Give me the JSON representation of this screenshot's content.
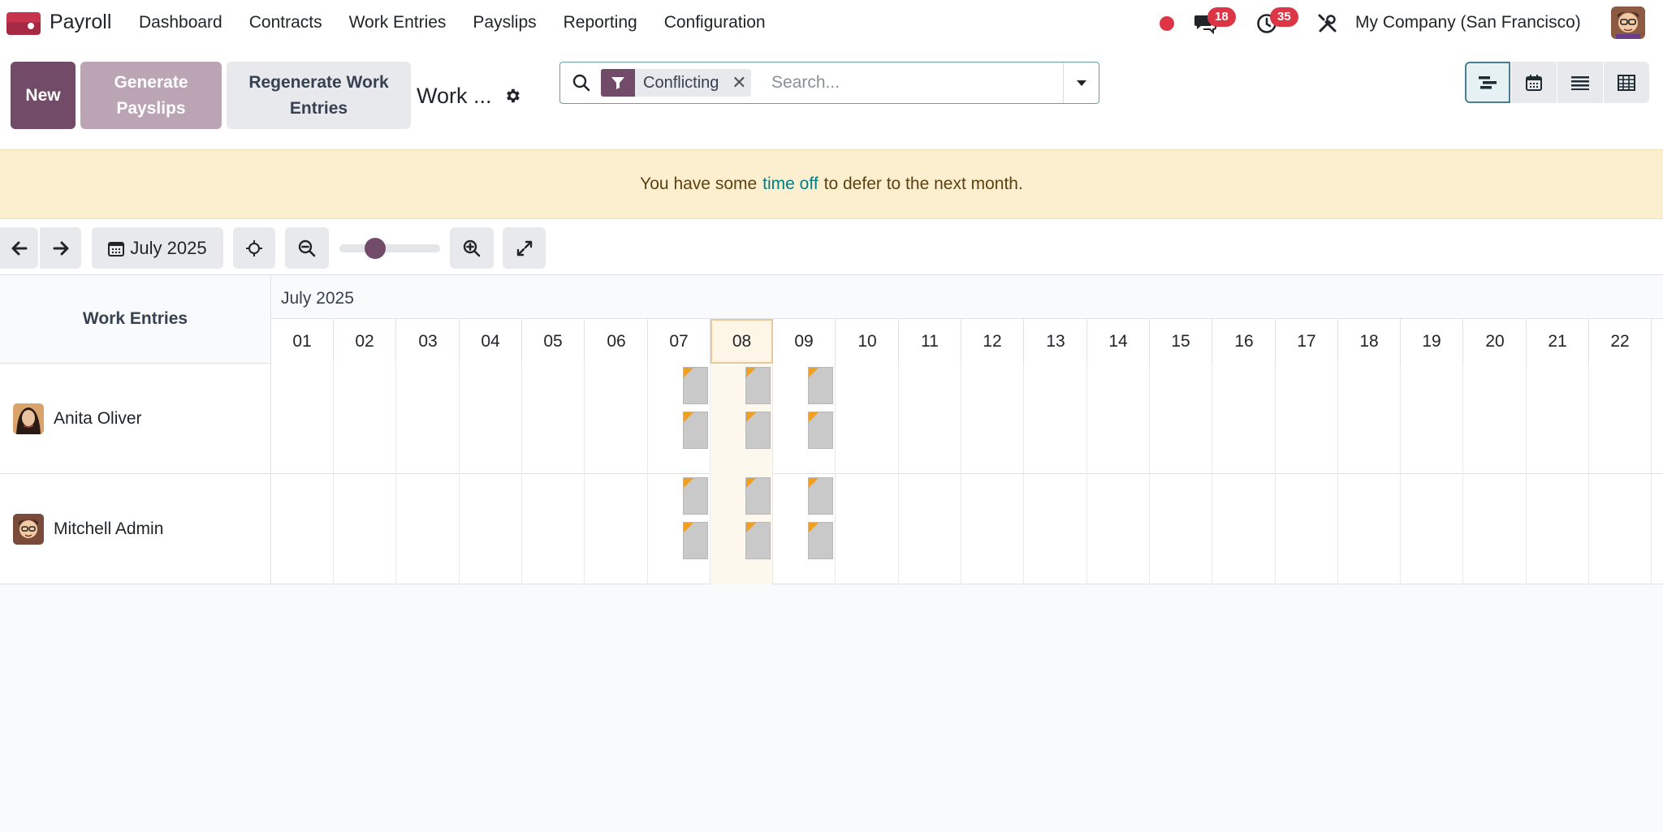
{
  "navbar": {
    "app_name": "Payroll",
    "menu": [
      "Dashboard",
      "Contracts",
      "Work Entries",
      "Payslips",
      "Reporting",
      "Configuration"
    ],
    "messages_count": "18",
    "activities_count": "35",
    "company": "My Company (San Francisco)",
    "status_color": "#dc3545"
  },
  "toolbar": {
    "new_label": "New",
    "generate_label": "Generate Payslips",
    "regenerate_label": "Regenerate Work Entries",
    "title": "Work ..."
  },
  "search": {
    "facet_label": "Conflicting",
    "facet_icon": "filter-icon",
    "placeholder": "Search..."
  },
  "views": [
    "gantt-view-icon",
    "calendar-view-icon",
    "list-view-icon",
    "pivot-view-icon"
  ],
  "alert": {
    "before": "You have some",
    "link": "time off",
    "after": "to defer to the next month."
  },
  "gantt_toolbar": {
    "date_label": "July 2025",
    "zoom_level": 0.25
  },
  "gantt": {
    "row_header": "Work Entries",
    "month_label": "July 2025",
    "days": [
      "01",
      "02",
      "03",
      "04",
      "05",
      "06",
      "07",
      "08",
      "09",
      "10",
      "11",
      "12",
      "13",
      "14",
      "15",
      "16",
      "17",
      "18",
      "19",
      "20",
      "21",
      "22"
    ],
    "today": "08",
    "rows": [
      {
        "name": "Anita Oliver",
        "conflict_days": [
          "07",
          "08",
          "09"
        ]
      },
      {
        "name": "Mitchell Admin",
        "conflict_days": [
          "07",
          "08",
          "09"
        ]
      }
    ]
  },
  "colors": {
    "brand": "#714b67",
    "conflict_flag": "#f0a020"
  }
}
